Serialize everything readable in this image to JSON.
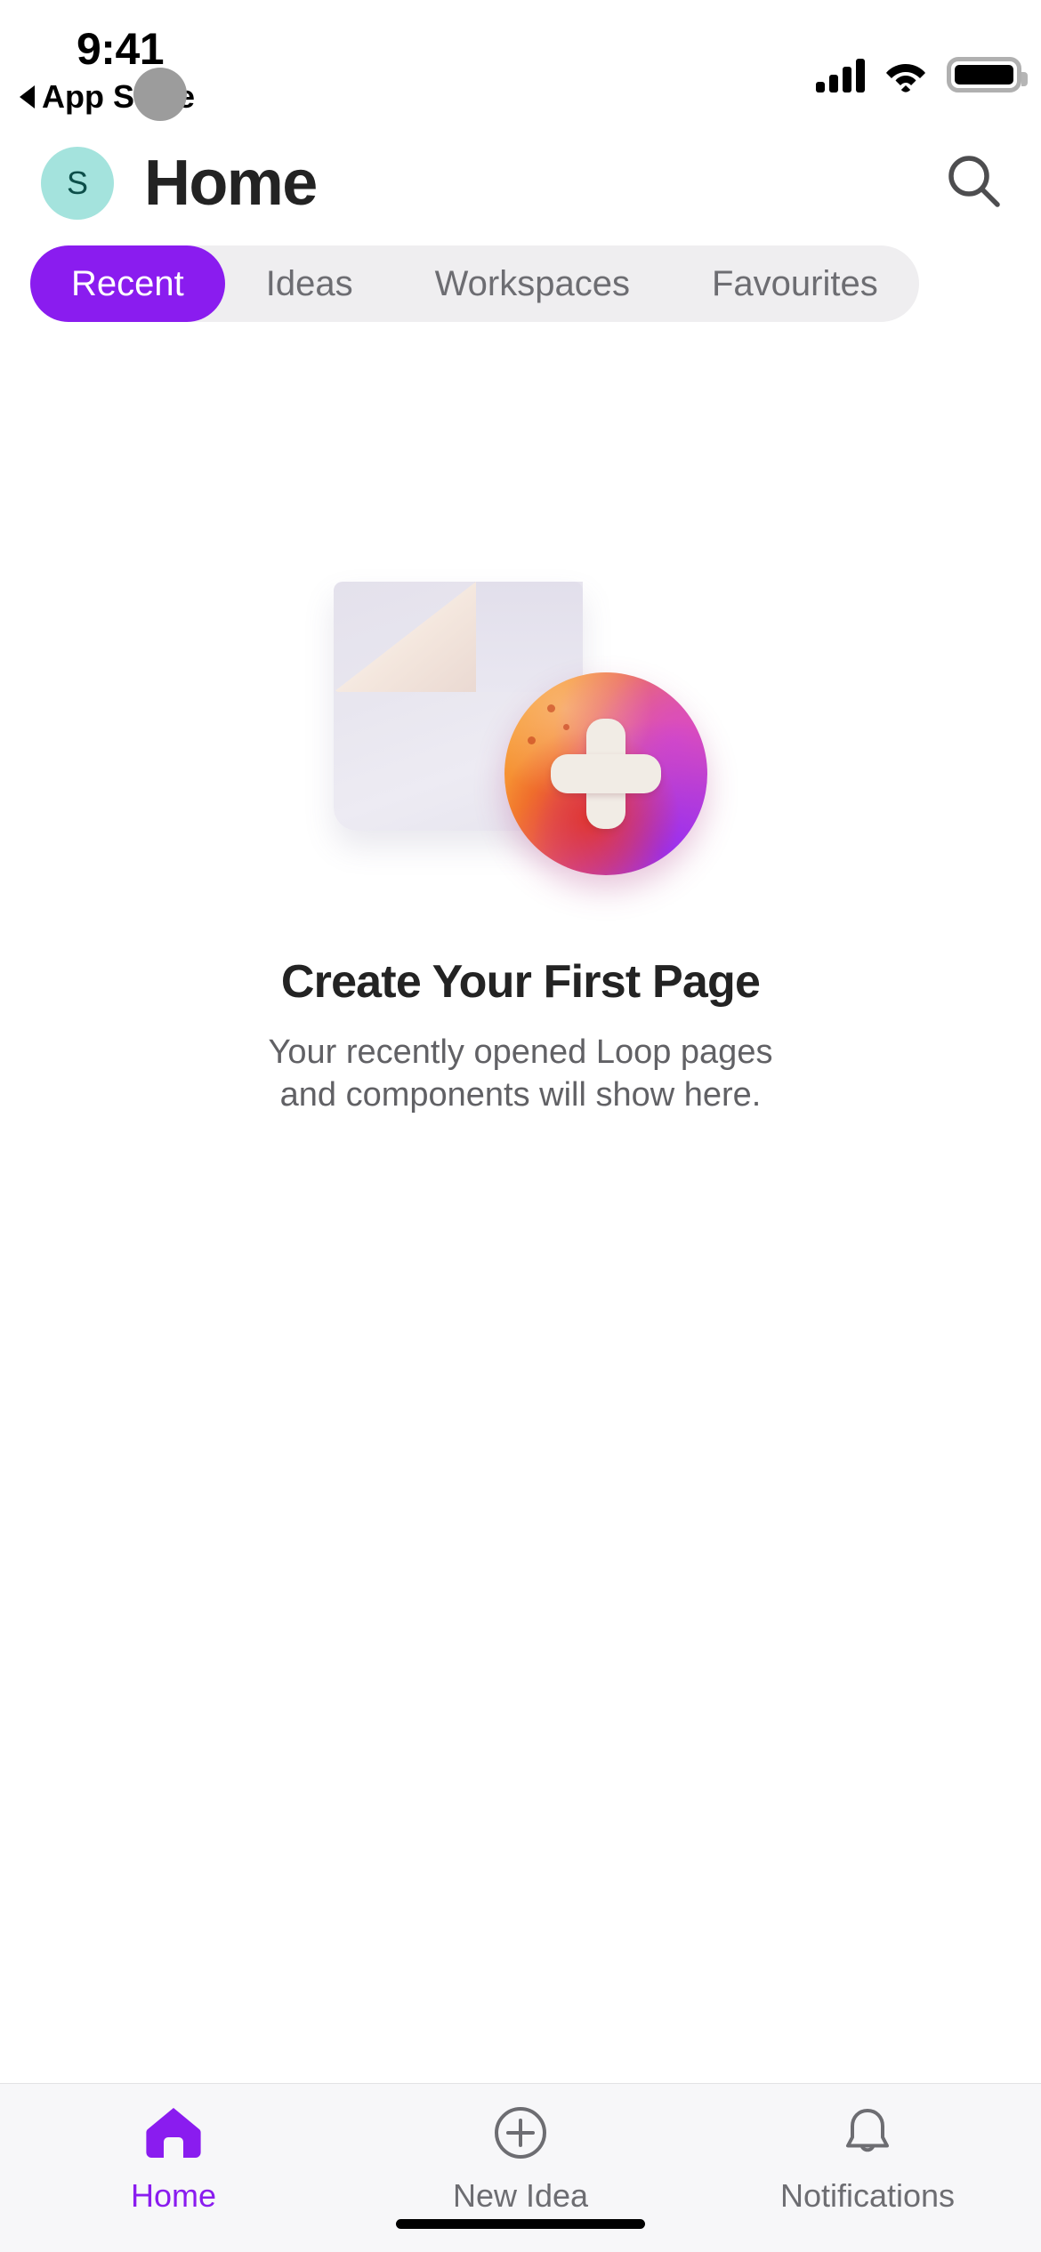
{
  "status_bar": {
    "time": "9:41",
    "back_label": "App Store",
    "back_icon": "triangle-left-icon",
    "island_icon": "dynamic-island",
    "cellular_icon": "cellular-bars-icon",
    "wifi_icon": "wifi-icon",
    "battery_icon": "battery-full-icon"
  },
  "header": {
    "avatar_initial": "S",
    "avatar_bg": "#a4e3dd",
    "avatar_fg": "#0d4f4a",
    "title": "Home",
    "search_icon": "search-icon"
  },
  "filter_tabs": {
    "active_index": 0,
    "track_bg": "#efeef0",
    "active_bg": "#8a1cef",
    "active_fg": "#ffffff",
    "inactive_fg": "#6d6d72",
    "items": [
      {
        "label": "Recent"
      },
      {
        "label": "Ideas"
      },
      {
        "label": "Workspaces"
      },
      {
        "label": "Favourites"
      }
    ]
  },
  "empty_state": {
    "illustration_icon": "new-page-illustration",
    "headline": "Create Your First Page",
    "subtitle": "Your recently opened Loop pages and components will show here."
  },
  "bottom_nav": {
    "active_index": 0,
    "accent": "#8a1cef",
    "inactive_fg": "#6d6d72",
    "bg": "#f7f7f9",
    "items": [
      {
        "label": "Home",
        "icon": "home-icon"
      },
      {
        "label": "New Idea",
        "icon": "plus-circle-icon"
      },
      {
        "label": "Notifications",
        "icon": "bell-icon"
      }
    ]
  }
}
